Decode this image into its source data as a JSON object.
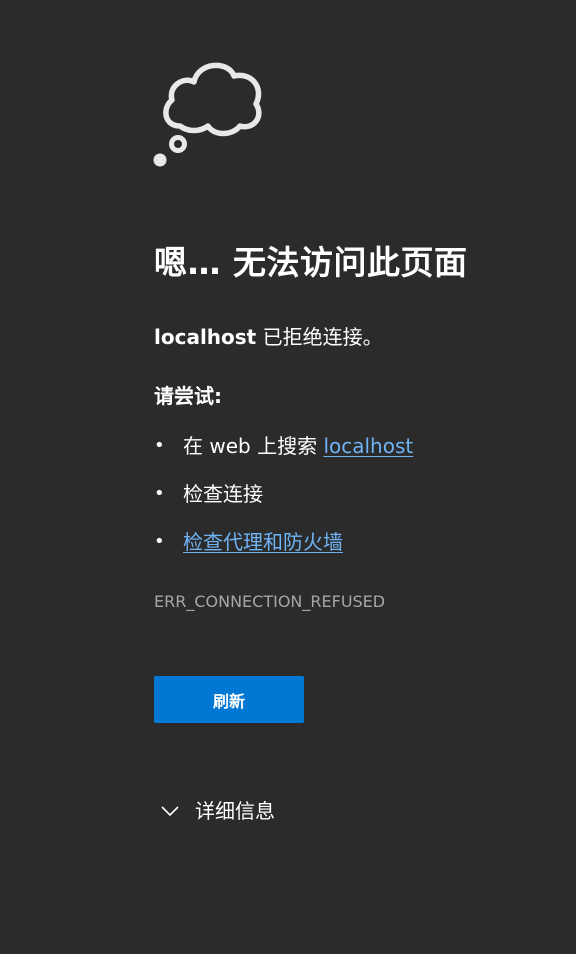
{
  "error_page": {
    "icon": "thought-cloud-icon",
    "title": "嗯… 无法访问此页面",
    "message_host": "localhost",
    "message_text": " 已拒绝连接。",
    "try_heading": "请尝试:",
    "suggestions": [
      {
        "prefix": "在 web 上搜索 ",
        "link": "localhost"
      },
      {
        "text": "检查连接"
      },
      {
        "link": "检查代理和防火墙"
      }
    ],
    "bullet": "•",
    "error_code": "ERR_CONNECTION_REFUSED",
    "refresh_label": "刷新",
    "details_label": "详细信息",
    "details_icon": "chevron-down-icon"
  },
  "colors": {
    "background": "#2b2b2b",
    "text": "#ffffff",
    "link": "#6fb3f5",
    "error_code": "#a6a6a6",
    "button": "#0078d4"
  }
}
